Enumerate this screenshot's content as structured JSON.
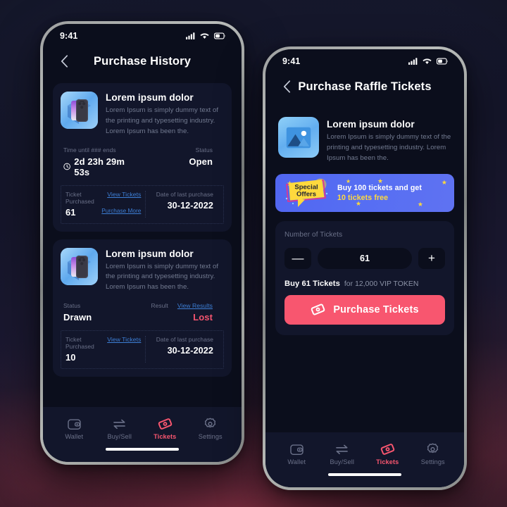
{
  "background": {
    "top_color": "#15182c",
    "glow_color": "#b03c50"
  },
  "theme": {
    "accent": "#f8566f",
    "card_bg": "#12162b",
    "screen_bg": "#0b0e1c",
    "link": "#3d7fd6",
    "banner_blue": "#5166f0",
    "banner_yellow": "#ffd93d",
    "lost_red": "#f4546f"
  },
  "phone_left": {
    "status_bar": {
      "time": "9:41",
      "icons": [
        "cellular-signal-icon",
        "wifi-icon",
        "battery-icon"
      ]
    },
    "header": {
      "back_icon": "chevron-left-icon",
      "title": "Purchase History"
    },
    "cards": [
      {
        "thumbnail": "iphone-product-image",
        "title": "Lorem ipsum dolor",
        "description": "Lorem Ipsum is simply dummy text of the printing and typesetting industry. Lorem Ipsum has been the.",
        "top_stats": [
          {
            "label": "Time until ### ends",
            "value": "2d 23h 29m 53s",
            "icon": "clock-icon"
          },
          {
            "label": "Status",
            "value": "Open"
          }
        ],
        "bottom": {
          "ticket_label": "Ticket Purchased",
          "ticket_count": "61",
          "link_primary": "View Tickets",
          "link_secondary": "Purchase More",
          "date_label": "Date of last purchase",
          "date_value": "30-12-2022"
        }
      },
      {
        "thumbnail": "iphone-product-image",
        "title": "Lorem ipsum dolor",
        "description": "Lorem Ipsum is simply dummy text of the printing and typesetting industry. Lorem Ipsum has been the.",
        "top_stats": [
          {
            "label": "Status",
            "value": "Drawn"
          },
          {
            "label": "Result",
            "value": "Lost",
            "link": "View Results"
          }
        ],
        "bottom": {
          "ticket_label": "Ticket Purchased",
          "ticket_count": "10",
          "link_primary": "View Tickets",
          "date_label": "Date of last purchase",
          "date_value": "30-12-2022"
        }
      }
    ],
    "tabs": [
      {
        "label": "Wallet",
        "icon": "wallet-icon",
        "active": false
      },
      {
        "label": "Buy/Sell",
        "icon": "swap-arrows-icon",
        "active": false
      },
      {
        "label": "Tickets",
        "icon": "ticket-icon",
        "active": true
      },
      {
        "label": "Settings",
        "icon": "gear-icon",
        "active": false
      }
    ]
  },
  "phone_right": {
    "status_bar": {
      "time": "9:41",
      "icons": [
        "cellular-signal-icon",
        "wifi-icon",
        "battery-icon"
      ]
    },
    "header": {
      "back_icon": "chevron-left-icon",
      "title": "Purchase Raffle Tickets"
    },
    "product": {
      "thumbnail": "image-placeholder-icon",
      "title": "Lorem ipsum dolor",
      "description": "Lorem Ipsum is simply dummy text of the printing and typesetting industry. Lorem Ipsum has been the."
    },
    "offer_banner": {
      "badge_line1": "Special",
      "badge_line2": "Offers",
      "headline": "Buy 100 tickets and get",
      "subline": "10 tickets free"
    },
    "purchase": {
      "quantity_label": "Number of Tickets",
      "decrement_label": "—",
      "increment_label": "+",
      "quantity_value": "61",
      "summary_strong": "Buy 61 Tickets",
      "summary_soft": "for 12,000 VIP TOKEN",
      "cta_label": "Purchase Tickets",
      "cta_icon": "ticket-icon"
    },
    "tabs": [
      {
        "label": "Wallet",
        "icon": "wallet-icon",
        "active": false
      },
      {
        "label": "Buy/Sell",
        "icon": "swap-arrows-icon",
        "active": false
      },
      {
        "label": "Tickets",
        "icon": "ticket-icon",
        "active": true
      },
      {
        "label": "Settings",
        "icon": "gear-icon",
        "active": false
      }
    ]
  }
}
